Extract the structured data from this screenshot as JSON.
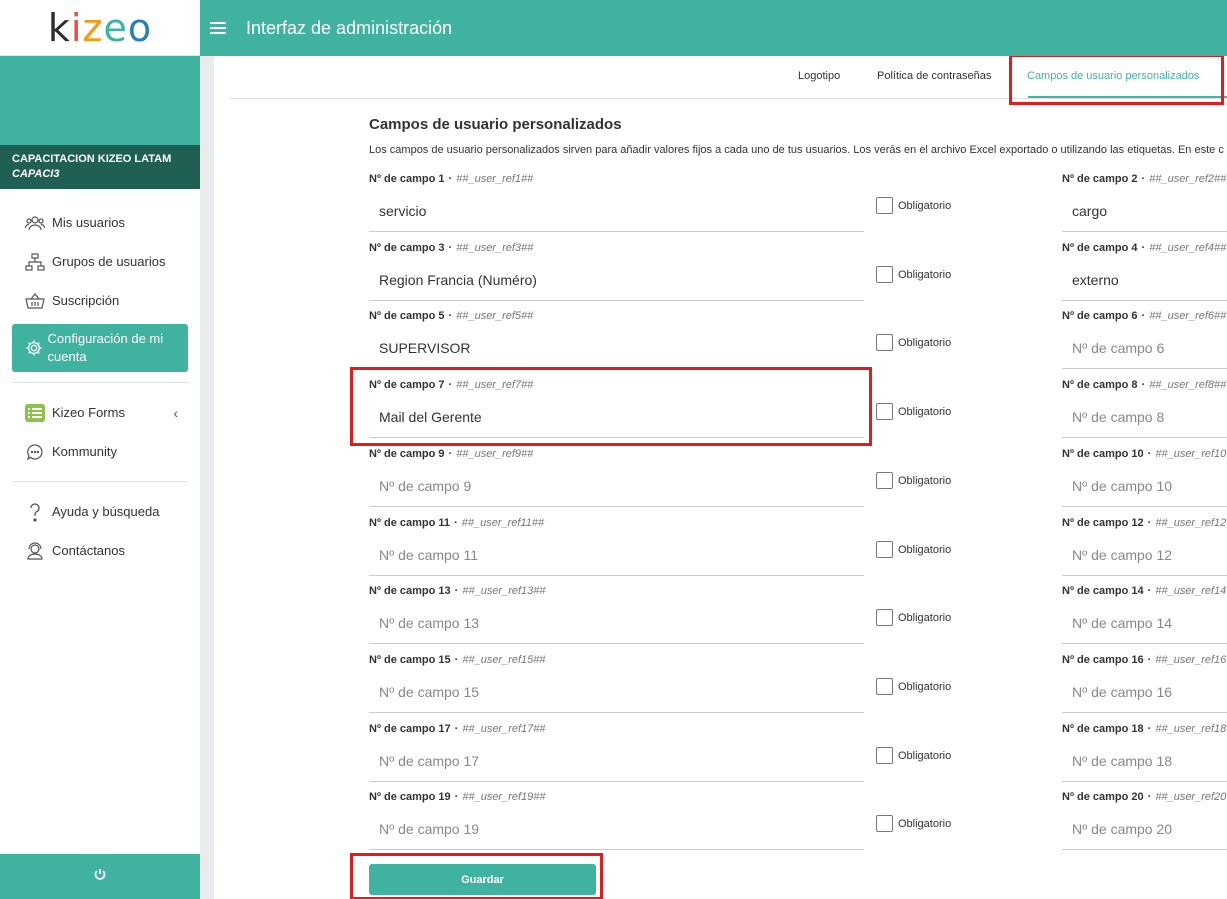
{
  "logo": {
    "k": "k",
    "i": "i",
    "z": "z",
    "e": "e",
    "o": "o"
  },
  "header": {
    "title": "Interfaz de administración"
  },
  "org": {
    "name": "CAPACITACION KIZEO LATAM",
    "code": "CAPACI3"
  },
  "sidebar": {
    "items": [
      {
        "label": "Mis usuarios",
        "icon": "users-icon"
      },
      {
        "label": "Grupos de usuarios",
        "icon": "hierarchy-icon"
      },
      {
        "label": "Suscripción",
        "icon": "basket-icon"
      },
      {
        "label": "Configuración de mi cuenta",
        "icon": "gear-icon"
      },
      {
        "label": "Kizeo Forms",
        "icon": "forms-icon"
      },
      {
        "label": "Kommunity",
        "icon": "chat-icon"
      },
      {
        "label": "Ayuda y búsqueda",
        "icon": "help-icon"
      },
      {
        "label": "Contáctanos",
        "icon": "support-icon"
      }
    ]
  },
  "tabs": [
    {
      "label": "Logotipo"
    },
    {
      "label": "Política de contraseñas"
    },
    {
      "label": "Campos de usuario personalizados"
    }
  ],
  "section": {
    "title": "Campos de usuario personalizados",
    "description": "Los campos de usuario personalizados sirven para añadir valores fijos a cada uno de tus usuarios. Los verás en el archivo Excel exportado o utilizando las etiquetas. En este c"
  },
  "fields": [
    {
      "label": "Nº de campo 1",
      "ref": "##_user_ref1##",
      "value": "servicio",
      "placeholder": "Nº de campo 1",
      "checkbox": "Obligatorio"
    },
    {
      "label": "Nº de campo 2",
      "ref": "##_user_ref2##",
      "value": "cargo",
      "placeholder": "Nº de campo 2"
    },
    {
      "label": "Nº de campo 3",
      "ref": "##_user_ref3##",
      "value": "Region Francia (Numéro)",
      "placeholder": "Nº de campo 3",
      "checkbox": "Obligatorio"
    },
    {
      "label": "Nº de campo 4",
      "ref": "##_user_ref4##",
      "value": "externo",
      "placeholder": "Nº de campo 4"
    },
    {
      "label": "Nº de campo 5",
      "ref": "##_user_ref5##",
      "value": "SUPERVISOR",
      "placeholder": "Nº de campo 5",
      "checkbox": "Obligatorio"
    },
    {
      "label": "Nº de campo 6",
      "ref": "##_user_ref6##",
      "value": "",
      "placeholder": "Nº de campo 6"
    },
    {
      "label": "Nº de campo 7",
      "ref": "##_user_ref7##",
      "value": "Mail del Gerente",
      "placeholder": "Nº de campo 7",
      "checkbox": "Obligatorio"
    },
    {
      "label": "Nº de campo 8",
      "ref": "##_user_ref8##",
      "value": "",
      "placeholder": "Nº de campo 8"
    },
    {
      "label": "Nº de campo 9",
      "ref": "##_user_ref9##",
      "value": "",
      "placeholder": "Nº de campo 9",
      "checkbox": "Obligatorio"
    },
    {
      "label": "Nº de campo 10",
      "ref": "##_user_ref10",
      "value": "",
      "placeholder": "Nº de campo 10"
    },
    {
      "label": "Nº de campo 11",
      "ref": "##_user_ref11##",
      "value": "",
      "placeholder": "Nº de campo 11",
      "checkbox": "Obligatorio"
    },
    {
      "label": "Nº de campo 12",
      "ref": "##_user_ref12",
      "value": "",
      "placeholder": "Nº de campo 12"
    },
    {
      "label": "Nº de campo 13",
      "ref": "##_user_ref13##",
      "value": "",
      "placeholder": "Nº de campo 13",
      "checkbox": "Obligatorio"
    },
    {
      "label": "Nº de campo 14",
      "ref": "##_user_ref14",
      "value": "",
      "placeholder": "Nº de campo 14"
    },
    {
      "label": "Nº de campo 15",
      "ref": "##_user_ref15##",
      "value": "",
      "placeholder": "Nº de campo 15",
      "checkbox": "Obligatorio"
    },
    {
      "label": "Nº de campo 16",
      "ref": "##_user_ref16",
      "value": "",
      "placeholder": "Nº de campo 16"
    },
    {
      "label": "Nº de campo 17",
      "ref": "##_user_ref17##",
      "value": "",
      "placeholder": "Nº de campo 17",
      "checkbox": "Obligatorio"
    },
    {
      "label": "Nº de campo 18",
      "ref": "##_user_ref18",
      "value": "",
      "placeholder": "Nº de campo 18"
    },
    {
      "label": "Nº de campo 19",
      "ref": "##_user_ref19##",
      "value": "",
      "placeholder": "Nº de campo 19",
      "checkbox": "Obligatorio"
    },
    {
      "label": "Nº de campo 20",
      "ref": "##_user_ref20",
      "value": "",
      "placeholder": "Nº de campo 20"
    }
  ],
  "save_label": "Guardar",
  "colors": {
    "accent": "#3fb39f",
    "dark": "#1f5f54",
    "highlight": "#e21b1b"
  }
}
